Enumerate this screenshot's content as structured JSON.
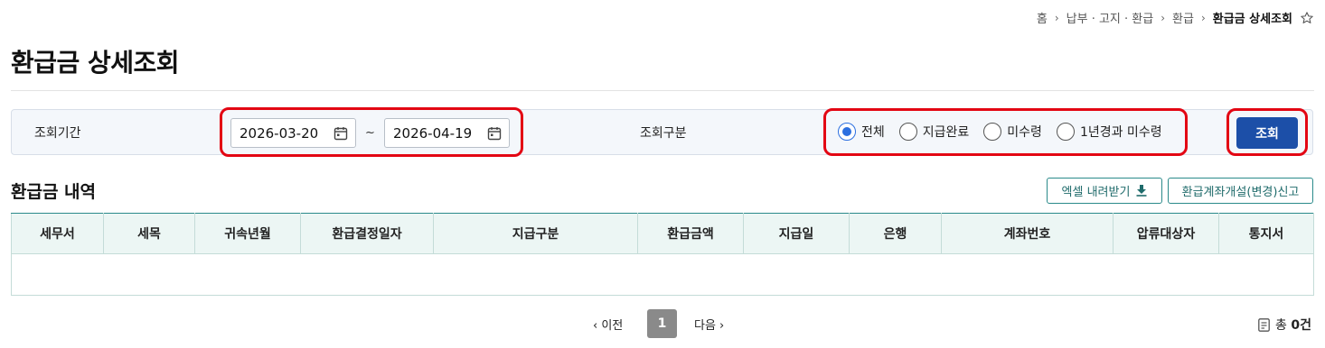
{
  "breadcrumb": {
    "home": "홈",
    "level1": "납부 · 고지 · 환급",
    "level2": "환급",
    "current": "환급금 상세조회"
  },
  "page": {
    "title": "환급금 상세조회"
  },
  "search": {
    "period_label": "조회기간",
    "date_from": "2026-03-20",
    "tilde": "~",
    "date_to": "2026-04-19",
    "type_label": "조회구분",
    "options": [
      {
        "label": "전체",
        "checked": true
      },
      {
        "label": "지급완료",
        "checked": false
      },
      {
        "label": "미수령",
        "checked": false
      },
      {
        "label": "1년경과 미수령",
        "checked": false
      }
    ],
    "button_label": "조회"
  },
  "section": {
    "title": "환급금 내역",
    "excel_label": "엑셀 내려받기",
    "account_label": "환급계좌개설(변경)신고"
  },
  "table": {
    "columns": [
      "세무서",
      "세목",
      "귀속년월",
      "환급결정일자",
      "지급구분",
      "환급금액",
      "지급일",
      "은행",
      "계좌번호",
      "압류대상자",
      "통지서"
    ],
    "rows": []
  },
  "pagination": {
    "prev": "이전",
    "current": "1",
    "next": "다음",
    "total_prefix": "총",
    "total_count": "0건"
  },
  "colors": {
    "primary_button": "#1c4fa8",
    "radio_checked": "#2c6fe0",
    "highlight": "#e30613",
    "table_header": "#ecf6f4",
    "accent_teal": "#2a8a8a"
  }
}
